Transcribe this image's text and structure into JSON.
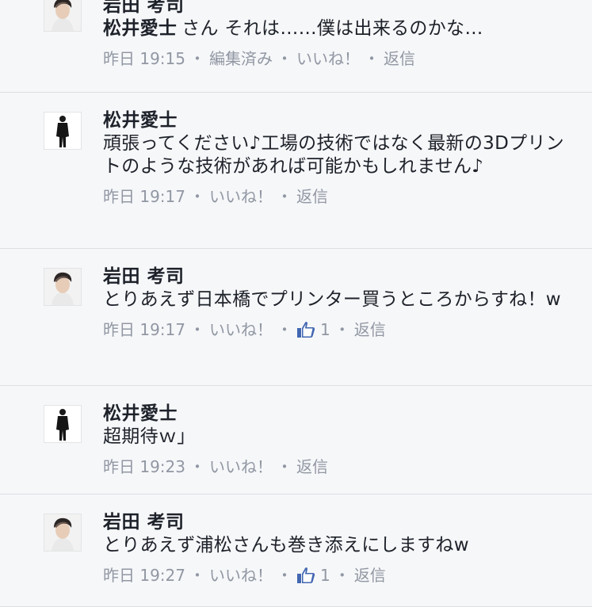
{
  "comments": [
    {
      "author": "岩田 考司",
      "mention": "松井愛士",
      "text": "さん それは……僕は出来るのかな…",
      "time": "昨日 19:15",
      "edited": "編集済み",
      "like": "いいね！",
      "reply": "返信",
      "avatar": "avatar-iwata"
    },
    {
      "author": "松井愛士",
      "text": "頑張ってください♪工場の技術ではなく最新の3Dプリントのような技術があれば可能かもしれません♪",
      "time": "昨日 19:17",
      "like": "いいね！",
      "reply": "返信",
      "avatar": "avatar-matsui"
    },
    {
      "author": "岩田 考司",
      "text": "とりあえず日本橋でプリンター買うところからすね！w",
      "time": "昨日 19:17",
      "like": "いいね！",
      "like_count": "1",
      "reply": "返信",
      "avatar": "avatar-iwata"
    },
    {
      "author": "松井愛士",
      "text": "超期待ｗ」",
      "time": "昨日 19:23",
      "like": "いいね！",
      "reply": "返信",
      "avatar": "avatar-matsui"
    },
    {
      "author": "岩田 考司",
      "text": "とりあえず浦松さんも巻き添えにしますねw",
      "time": "昨日 19:27",
      "like": "いいね！",
      "like_count": "1",
      "reply": "返信",
      "avatar": "avatar-iwata"
    }
  ],
  "meta_separator": "・",
  "colors": {
    "background": "#f6f7f9",
    "text": "#1d2129",
    "meta": "#9197a3",
    "divider": "#dddfe2",
    "like_icon": "#4267b2"
  }
}
